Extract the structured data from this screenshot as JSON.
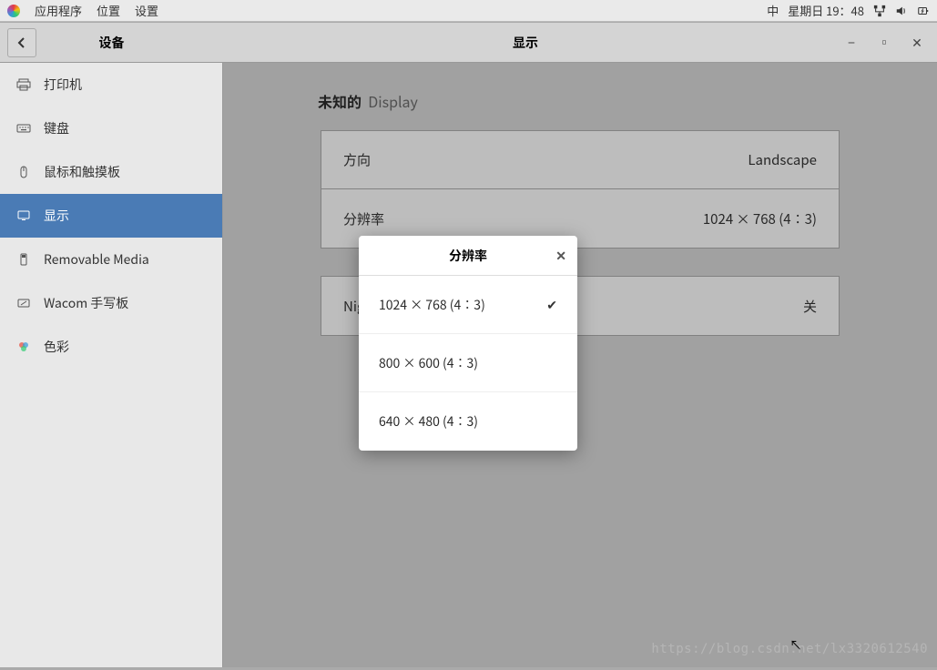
{
  "topbar": {
    "menus": [
      "应用程序",
      "位置",
      "设置"
    ],
    "input_method": "中",
    "datetime": "星期日 19：48"
  },
  "header": {
    "back_aria": "返回",
    "title_left": "设备",
    "title_center": "显示"
  },
  "sidebar": {
    "items": [
      {
        "icon": "printer",
        "label": "打印机"
      },
      {
        "icon": "keyboard",
        "label": "键盘"
      },
      {
        "icon": "mouse",
        "label": "鼠标和触摸板"
      },
      {
        "icon": "display",
        "label": "显示",
        "active": true
      },
      {
        "icon": "removable",
        "label": "Removable Media"
      },
      {
        "icon": "tablet",
        "label": "Wacom 手写板"
      },
      {
        "icon": "color",
        "label": "色彩"
      }
    ]
  },
  "content": {
    "section_prefix": "未知的",
    "section_suffix": "Display",
    "rows": [
      {
        "label": "方向",
        "value": "Landscape"
      },
      {
        "label": "分辨率",
        "value": "1024 × 768 (4∶3)"
      }
    ],
    "night_row": {
      "label": "Night Light",
      "value": "关"
    }
  },
  "popup": {
    "title": "分辨率",
    "options": [
      {
        "label": "1024 × 768 (4∶3)",
        "selected": true
      },
      {
        "label": "800 × 600 (4∶3)",
        "selected": false
      },
      {
        "label": "640 × 480 (4∶3)",
        "selected": false
      }
    ]
  },
  "watermark": "https://blog.csdn.net/lx3320612540"
}
